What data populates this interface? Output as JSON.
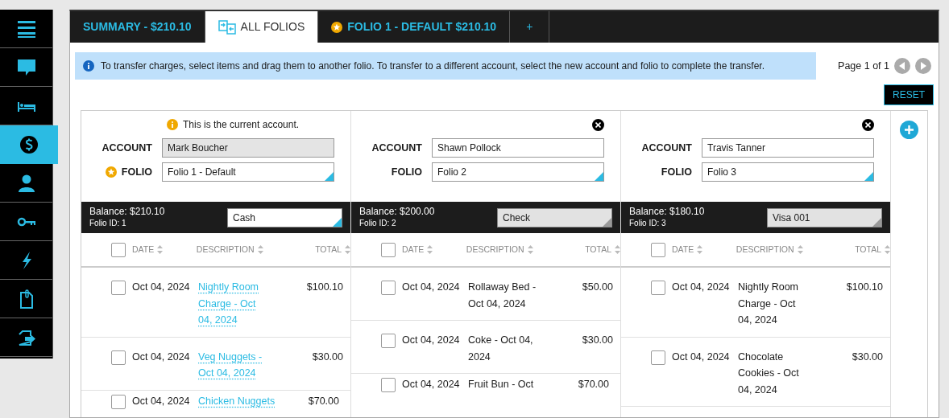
{
  "sidebar": {
    "items": [
      {
        "kind": "menu",
        "selected": false
      },
      {
        "kind": "chat",
        "selected": false
      },
      {
        "kind": "bed",
        "selected": false
      },
      {
        "kind": "money",
        "selected": true
      },
      {
        "kind": "person",
        "selected": false
      },
      {
        "kind": "key",
        "selected": false
      },
      {
        "kind": "bolt",
        "selected": false
      },
      {
        "kind": "clipboard",
        "selected": false
      },
      {
        "kind": "exit",
        "selected": false
      }
    ]
  },
  "tabs": [
    {
      "kind": "plain",
      "label": "SUMMARY - $210.10",
      "selected": false
    },
    {
      "kind": "transfer",
      "label": "ALL FOLIOS",
      "selected": true
    },
    {
      "kind": "default",
      "label": "FOLIO 1 - DEFAULT $210.10",
      "selected": false
    },
    {
      "kind": "add",
      "label": "+",
      "selected": false
    }
  ],
  "info": "To transfer charges, select items and drag them to another folio. To transfer to a different account, select the new account and folio to complete the transfer.",
  "pager": {
    "label": "Page 1 of 1"
  },
  "reset": "RESET",
  "folios": [
    {
      "removable": false,
      "note": "This is the current account.",
      "account_label": "ACCOUNT",
      "account": "Mark Boucher",
      "account_locked": true,
      "folio_label": "FOLIO",
      "default": true,
      "folio": "Folio 1  - Default",
      "balance": "Balance: $210.10",
      "folio_id": "Folio ID: 1",
      "payment": "Cash",
      "payment_disabled": false,
      "columns": [
        "DATE",
        "DESCRIPTION",
        "TOTAL"
      ],
      "all_checked": false,
      "charges": [
        {
          "checked": false,
          "date": "Oct 04, 2024",
          "description": "Nightly Room Charge - Oct 04, 2024",
          "linked": true,
          "total": "$100.10"
        },
        {
          "checked": false,
          "date": "Oct 04, 2024",
          "description": "Veg Nuggets - Oct 04, 2024",
          "linked": true,
          "total": "$30.00"
        },
        {
          "checked": false,
          "date": "Oct 04, 2024",
          "description": "Chicken Nuggets",
          "linked": true,
          "total": "$70.00"
        }
      ]
    },
    {
      "removable": true,
      "account_label": "ACCOUNT",
      "account": "Shawn Pollock",
      "account_locked": false,
      "folio_label": "FOLIO",
      "default": false,
      "folio": "Folio 2",
      "balance": "Balance: $200.00",
      "folio_id": "Folio ID: 2",
      "payment": "Check",
      "payment_disabled": true,
      "columns": [
        "DATE",
        "DESCRIPTION",
        "TOTAL"
      ],
      "all_checked": false,
      "charges": [
        {
          "checked": false,
          "date": "Oct 04, 2024",
          "description": "Rollaway Bed - Oct 04, 2024",
          "linked": false,
          "total": "$50.00"
        },
        {
          "checked": false,
          "date": "Oct 04, 2024",
          "description": "Coke - Oct 04, 2024",
          "linked": false,
          "total": "$30.00"
        },
        {
          "checked": false,
          "date": "Oct 04, 2024",
          "description": "Fruit Bun - Oct",
          "linked": false,
          "total": "$70.00"
        }
      ]
    },
    {
      "removable": true,
      "account_label": "ACCOUNT",
      "account": "Travis Tanner",
      "account_locked": false,
      "folio_label": "FOLIO",
      "default": false,
      "folio": "Folio 3",
      "balance": "Balance: $180.10",
      "folio_id": "Folio ID: 3",
      "payment": "Visa 001",
      "payment_disabled": true,
      "columns": [
        "DATE",
        "DESCRIPTION",
        "TOTAL"
      ],
      "all_checked": false,
      "charges": [
        {
          "checked": false,
          "date": "Oct 04, 2024",
          "description": "Nightly Room Charge - Oct 04, 2024",
          "linked": false,
          "total": "$100.10"
        },
        {
          "checked": false,
          "date": "Oct 04, 2024",
          "description": "Chocolate Cookies - Oct 04, 2024",
          "linked": false,
          "total": "$30.00"
        }
      ]
    }
  ]
}
